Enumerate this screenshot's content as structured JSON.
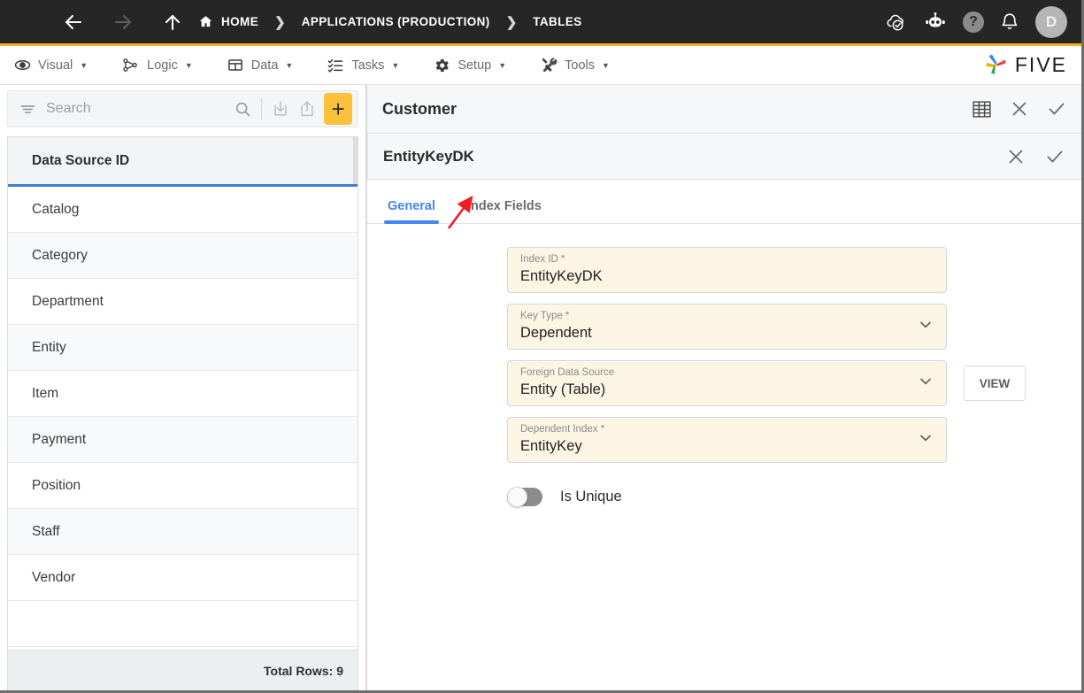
{
  "topbar": {
    "menu_icon": "hamburger-icon",
    "back_label": "←",
    "forward_label": "→",
    "up_label": "↑",
    "breadcrumbs": [
      {
        "label": "HOME",
        "icon": "home-icon"
      },
      {
        "label": "APPLICATIONS (PRODUCTION)",
        "icon": ""
      },
      {
        "label": "TABLES",
        "icon": ""
      }
    ],
    "separator": "❯",
    "actions": [
      {
        "name": "cloud-check-icon"
      },
      {
        "name": "robot-icon"
      },
      {
        "name": "help-icon",
        "label": "?"
      },
      {
        "name": "bell-icon"
      }
    ],
    "avatar_initial": "D",
    "accent_color": "#f0b323",
    "background_color": "#262626"
  },
  "menubar": {
    "items": [
      {
        "label": "Visual",
        "icon": "eye-icon",
        "caret": "▼"
      },
      {
        "label": "Logic",
        "icon": "logic-nodes-icon",
        "caret": "▼"
      },
      {
        "label": "Data",
        "icon": "table-grid-icon",
        "caret": "▼"
      },
      {
        "label": "Tasks",
        "icon": "task-list-icon",
        "caret": "▼"
      },
      {
        "label": "Setup",
        "icon": "gear-icon",
        "caret": "▼"
      },
      {
        "label": "Tools",
        "icon": "tools-icon",
        "caret": "▼"
      }
    ],
    "brand": "FIVE"
  },
  "sidebar": {
    "search": {
      "value": "",
      "placeholder": "Search"
    },
    "toolbar": [
      {
        "name": "filter-icon"
      },
      {
        "name": "search-icon"
      },
      {
        "name": "import-icon"
      },
      {
        "name": "export-icon"
      },
      {
        "name": "add-button",
        "label": "+"
      }
    ],
    "grid": {
      "column_header": "Data Source ID",
      "rows": [
        "Catalog",
        "Category",
        "Department",
        "Entity",
        "Item",
        "Payment",
        "Position",
        "Staff",
        "Vendor"
      ],
      "footer": "Total Rows: 9",
      "header_underline_color": "#3d7fd1"
    }
  },
  "main": {
    "panel": {
      "title": "Customer",
      "actions": [
        {
          "name": "table-view-icon"
        },
        {
          "name": "close-icon",
          "label": "✕"
        },
        {
          "name": "confirm-icon",
          "label": "✓"
        }
      ]
    },
    "subpanel": {
      "title": "EntityKeyDK",
      "actions": [
        {
          "name": "close-icon",
          "label": "✕"
        },
        {
          "name": "confirm-icon",
          "label": "✓"
        }
      ]
    },
    "tabs": [
      {
        "label": "General",
        "active": true
      },
      {
        "label": "Index Fields",
        "active": false
      }
    ],
    "active_tab_color": "#4285f4",
    "form": {
      "fields": [
        {
          "label": "Index ID *",
          "value": "EntityKeyDK",
          "type": "text",
          "has_view_button": false,
          "view_label": ""
        },
        {
          "label": "Key Type *",
          "value": "Dependent",
          "type": "select",
          "has_view_button": false,
          "view_label": ""
        },
        {
          "label": "Foreign Data Source",
          "value": "Entity (Table)",
          "type": "select",
          "has_view_button": true,
          "view_label": "VIEW"
        },
        {
          "label": "Dependent Index *",
          "value": "EntityKey",
          "type": "select",
          "has_view_button": false,
          "view_label": ""
        }
      ],
      "toggle": {
        "label": "Is Unique",
        "on": false
      },
      "field_background": "#fdf5e3"
    },
    "annotation": {
      "name": "red-arrow-annotation",
      "color": "#ee1c25"
    }
  }
}
